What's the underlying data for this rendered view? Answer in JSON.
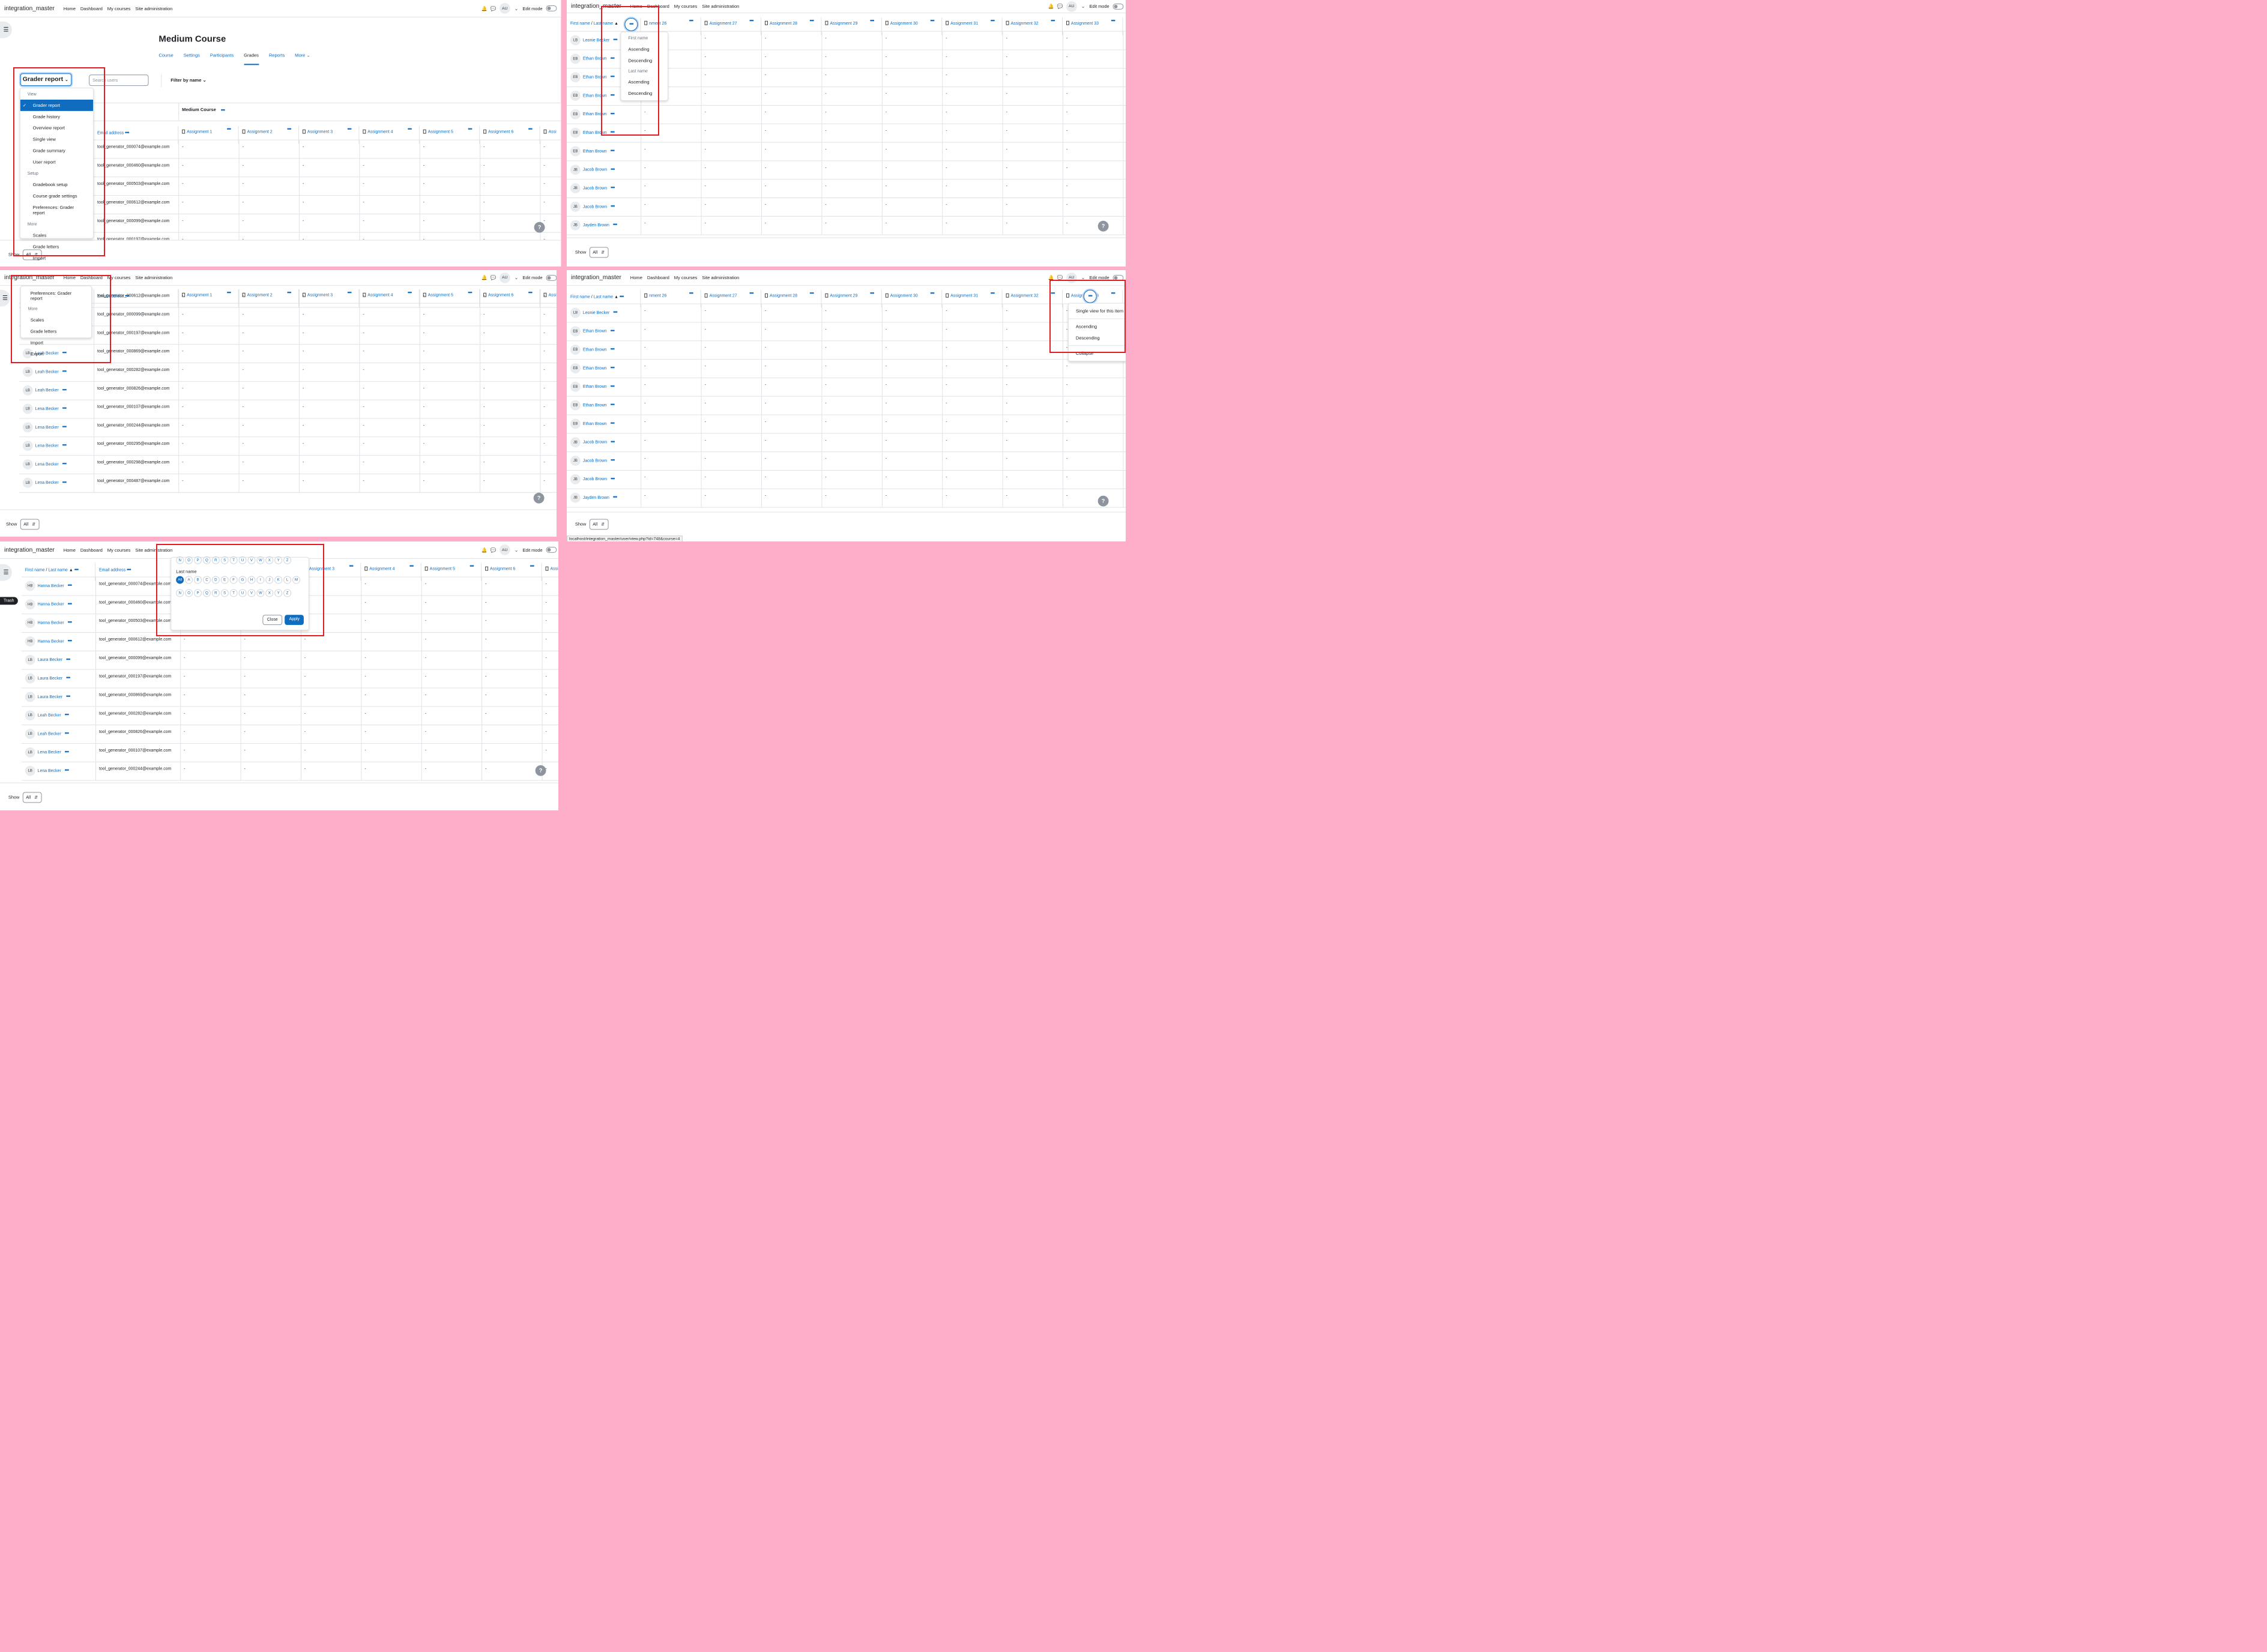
{
  "nav": {
    "brand": "integration_master",
    "links": [
      "Home",
      "Dashboard",
      "My courses",
      "Site administration"
    ],
    "avatar": "AU",
    "edit_mode": "Edit mode"
  },
  "footer": {
    "show_label": "Show",
    "show_value": "All"
  },
  "course": {
    "title": "Medium Course",
    "tabs": [
      "Course",
      "Settings",
      "Participants",
      "Grades",
      "Reports",
      "More"
    ],
    "category": "Medium Course"
  },
  "report_select": {
    "label": "Grader report",
    "search_placeholder": "Search users",
    "filter": "Filter by name"
  },
  "report_menu": {
    "view_heading": "View",
    "view": [
      "Grader report",
      "Grade history",
      "Overview report",
      "Single view",
      "Grade summary",
      "User report"
    ],
    "setup_heading": "Setup",
    "setup": [
      "Gradebook setup",
      "Course grade settings",
      "Preferences: Grader report"
    ],
    "more_heading": "More",
    "more": [
      "Scales",
      "Grade letters",
      "Import",
      "Export"
    ]
  },
  "columns": {
    "name": "First name",
    "name_sep": "/",
    "last": "Last name",
    "email": "Email address",
    "assign_left": [
      "Assignment 1",
      "Assignment 2",
      "Assignment 3",
      "Assignment 4",
      "Assignment 5",
      "Assignment 6",
      "Assi"
    ],
    "assign_right": [
      "nment 26",
      "Assignment 27",
      "Assignment 28",
      "Assignment 29",
      "Assignment 30",
      "Assignment 31",
      "Assignment 32",
      "Assignment 33",
      "Assignm"
    ]
  },
  "emails_a": [
    "tool_generator_000074@example.com",
    "tool_generator_000460@example.com",
    "tool_generator_000503@example.com",
    "tool_generator_000612@example.com",
    "tool_generator_000099@example.com",
    "tool_generator_000197@example.com"
  ],
  "emails_c": [
    "tool_generator_000612@example.com",
    "tool_generator_000099@example.com",
    "tool_generator_000197@example.com",
    "tool_generator_000869@example.com",
    "tool_generator_000282@example.com",
    "tool_generator_000826@example.com",
    "tool_generator_000107@example.com",
    "tool_generator_000244@example.com",
    "tool_generator_000295@example.com",
    "tool_generator_000298@example.com",
    "tool_generator_000487@example.com"
  ],
  "names_c": [
    "",
    "",
    "",
    "Leah Becker",
    "Leah Becker",
    "Leah Becker",
    "Lena Becker",
    "Lena Becker",
    "Lena Becker",
    "Lena Becker",
    "Lena Becker"
  ],
  "init_c": [
    "",
    "",
    "",
    "LB",
    "LB",
    "LB",
    "LB",
    "LB",
    "LB",
    "LB",
    "LB"
  ],
  "names_b": [
    "Leonie Becker",
    "Ethan Brown",
    "Ethan Brown",
    "Ethan Brown",
    "Ethan Brown",
    "Ethan Brown",
    "Ethan Brown",
    "Jacob Brown",
    "Jacob Brown",
    "Jacob Brown",
    "Jayden Brown"
  ],
  "init_b": [
    "LB",
    "EB",
    "EB",
    "EB",
    "EB",
    "EB",
    "EB",
    "JB",
    "JB",
    "JB",
    "JB"
  ],
  "names_e": [
    "Hanna Becker",
    "Hanna Becker",
    "Hanna Becker",
    "Hanna Becker",
    "Laura Becker",
    "Laura Becker",
    "Laura Becker",
    "Leah Becker",
    "Leah Becker",
    "Lena Becker",
    "Lena Becker"
  ],
  "init_e": [
    "HB",
    "HB",
    "HB",
    "HB",
    "LB",
    "LB",
    "LB",
    "LB",
    "LB",
    "LB",
    "LB"
  ],
  "emails_e": [
    "tool_generator_000074@example.com",
    "tool_generator_000460@example.com",
    "tool_generator_000503@example.com",
    "tool_generator_000612@example.com",
    "tool_generator_000099@example.com",
    "tool_generator_000197@example.com",
    "tool_generator_000869@example.com",
    "tool_generator_000282@example.com",
    "tool_generator_000826@example.com",
    "tool_generator_000107@example.com",
    "tool_generator_000244@example.com"
  ],
  "cell_value": "-",
  "sort_menu": {
    "first_heading": "First name",
    "last_heading": "Last name",
    "asc": "Ascending",
    "desc": "Descending"
  },
  "col_menu": {
    "single_view": "Single view for this item",
    "asc": "Ascending",
    "desc": "Descending",
    "collapse": "Collapse"
  },
  "status_url": "localhost/integration_master/user/view.php?id=748&course=4",
  "initials_filter": {
    "letters_top": [
      "N",
      "O",
      "P",
      "Q",
      "R",
      "S",
      "T",
      "U",
      "V",
      "W",
      "X",
      "Y",
      "Z"
    ],
    "last_label": "Last name",
    "all": "All",
    "letters_a": [
      "A",
      "B",
      "C",
      "D",
      "E",
      "F",
      "G",
      "H",
      "I",
      "J",
      "K",
      "L",
      "M"
    ],
    "letters_n": [
      "N",
      "O",
      "P",
      "Q",
      "R",
      "S",
      "T",
      "U",
      "V",
      "W",
      "X",
      "Y",
      "Z"
    ],
    "close": "Close",
    "apply": "Apply"
  },
  "trash_label": "Trash",
  "help": "?",
  "colors": {
    "accent": "#0f6cbf",
    "highlight": "#e31b23",
    "backdrop": "#ffaec9"
  }
}
